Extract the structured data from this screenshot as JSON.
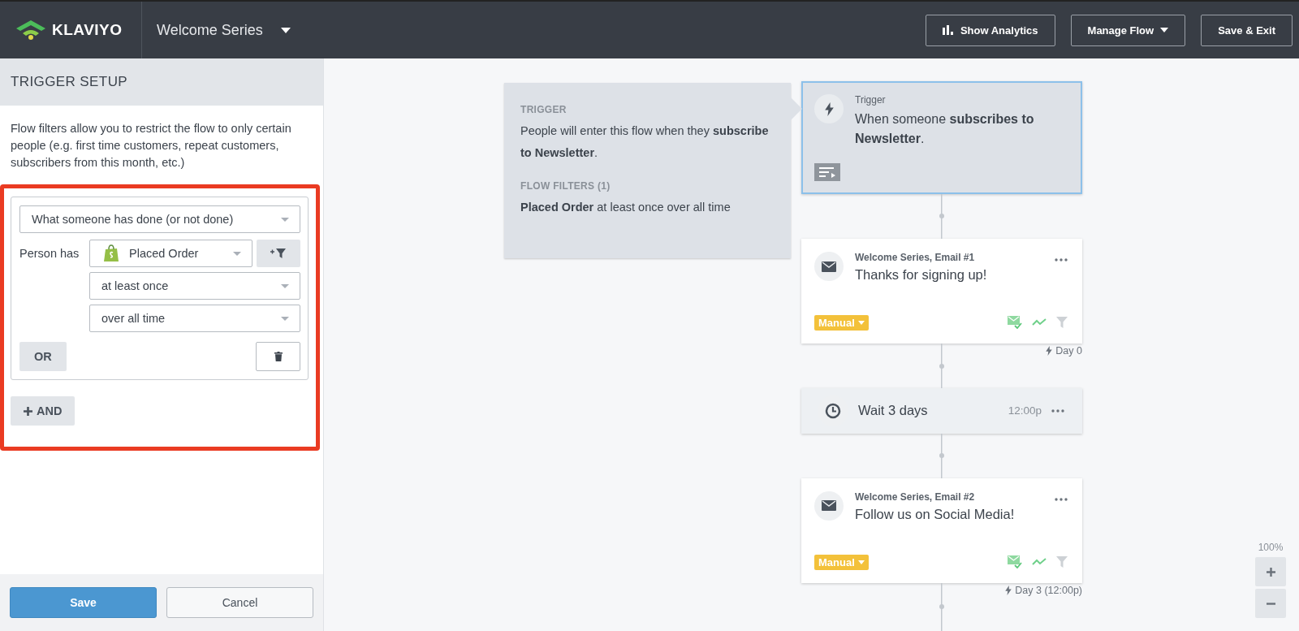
{
  "header": {
    "logo": "KLAVIYO",
    "flow_name": "Welcome Series",
    "buttons": [
      {
        "kind": "analytics",
        "label": "Show Analytics"
      },
      {
        "kind": "menu",
        "label": "Manage Flow"
      },
      {
        "kind": "plain",
        "label": "Save & Exit"
      }
    ]
  },
  "sidebar": {
    "title": "TRIGGER SETUP",
    "description": "Flow filters allow you to restrict the flow to only certain people (e.g. first time customers, repeat customers, subscribers from this month, etc.)",
    "filter": {
      "condition_type": "What someone has done (or not done)",
      "person_label": "Person has",
      "metric": "Placed Order",
      "frequency": "at least once",
      "timeframe": "over all time",
      "or_button": "OR"
    },
    "and_button": "AND",
    "footer_buttons": [
      {
        "kind": "primary",
        "label": "Save"
      },
      {
        "kind": "secondary",
        "label": "Cancel"
      }
    ]
  },
  "canvas": {
    "info": {
      "trigger_heading": "TRIGGER",
      "trigger_text": "People will enter this flow when they **subscribe to Newsletter**.",
      "filters_heading": "FLOW FILTERS (1)",
      "filters_text": "**Placed Order** at least once over all time"
    },
    "nodes": [
      {
        "kind": "trigger",
        "selected": true,
        "label": "Trigger",
        "text": "When someone **subscribes to Newsletter**."
      },
      {
        "kind": "email",
        "selected": false,
        "label": "Welcome Series, Email #1",
        "text": "Thanks for signing up!",
        "status": "Manual",
        "delay": "Day 0"
      },
      {
        "kind": "wait",
        "selected": false,
        "text": "Wait 3 days",
        "time": "12:00p"
      },
      {
        "kind": "email",
        "selected": false,
        "label": "Welcome Series, Email #2",
        "text": "Follow us on Social Media!",
        "status": "Manual",
        "delay": "Day 3 (12:00p)"
      }
    ],
    "zoom_level": "100%"
  }
}
